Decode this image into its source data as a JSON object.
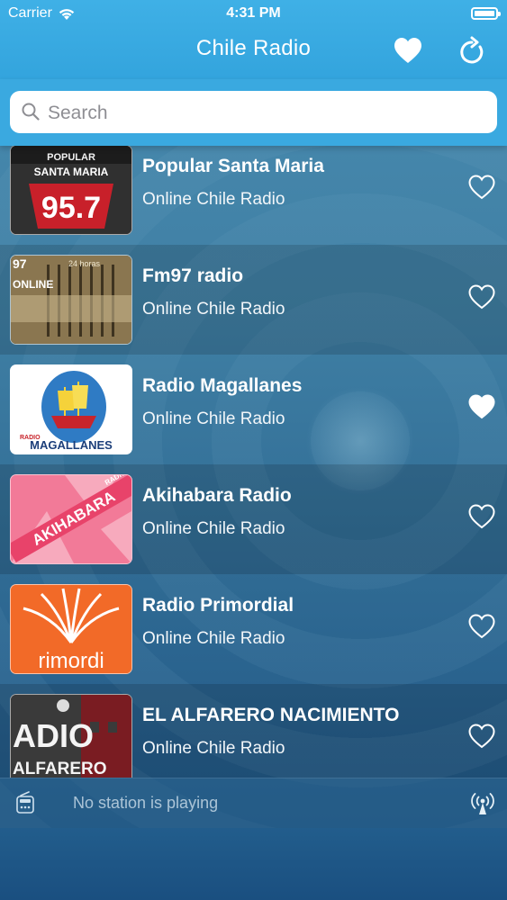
{
  "status_bar": {
    "carrier": "Carrier",
    "time": "4:31 PM",
    "wifi_icon": "wifi-icon",
    "battery_icon": "battery-icon"
  },
  "nav": {
    "title": "Chile Radio",
    "favorites_icon": "heart-icon",
    "refresh_icon": "refresh-icon"
  },
  "search": {
    "placeholder": "Search",
    "value": "",
    "icon": "search-icon"
  },
  "stations": [
    {
      "name": "Popular Santa Maria",
      "subtitle": "Online Chile Radio",
      "favorite": false,
      "logo": {
        "line1": "POPULAR",
        "line2": "SANTA MARIA",
        "line3": "95.7"
      }
    },
    {
      "name": "Fm97 radio",
      "subtitle": "Online Chile Radio",
      "favorite": false,
      "logo": {
        "line1": "97",
        "line2": "ONLINE",
        "line3": "24 horas"
      }
    },
    {
      "name": "Radio Magallanes",
      "subtitle": "Online Chile Radio",
      "favorite": true,
      "logo": {
        "line1": "RADIO",
        "line2": "MAGALLANES"
      }
    },
    {
      "name": "Akihabara Radio",
      "subtitle": "Online Chile Radio",
      "favorite": false,
      "logo": {
        "line1": "AKIHABARA",
        "line2": "RADIO"
      }
    },
    {
      "name": "Radio Primordial",
      "subtitle": "Online Chile Radio",
      "favorite": false,
      "logo": {
        "line1": "rimordi"
      }
    },
    {
      "name": "EL ALFARERO NACIMIENTO",
      "subtitle": "Online Chile Radio",
      "favorite": false,
      "logo": {
        "line1": "ADIO",
        "line2": "ALFARERO"
      }
    }
  ],
  "player": {
    "status": "No station is playing",
    "radio_icon": "radio-icon",
    "broadcast_icon": "broadcast-icon"
  },
  "colors": {
    "header": "#3aa9e0",
    "accent_white": "#ffffff"
  }
}
